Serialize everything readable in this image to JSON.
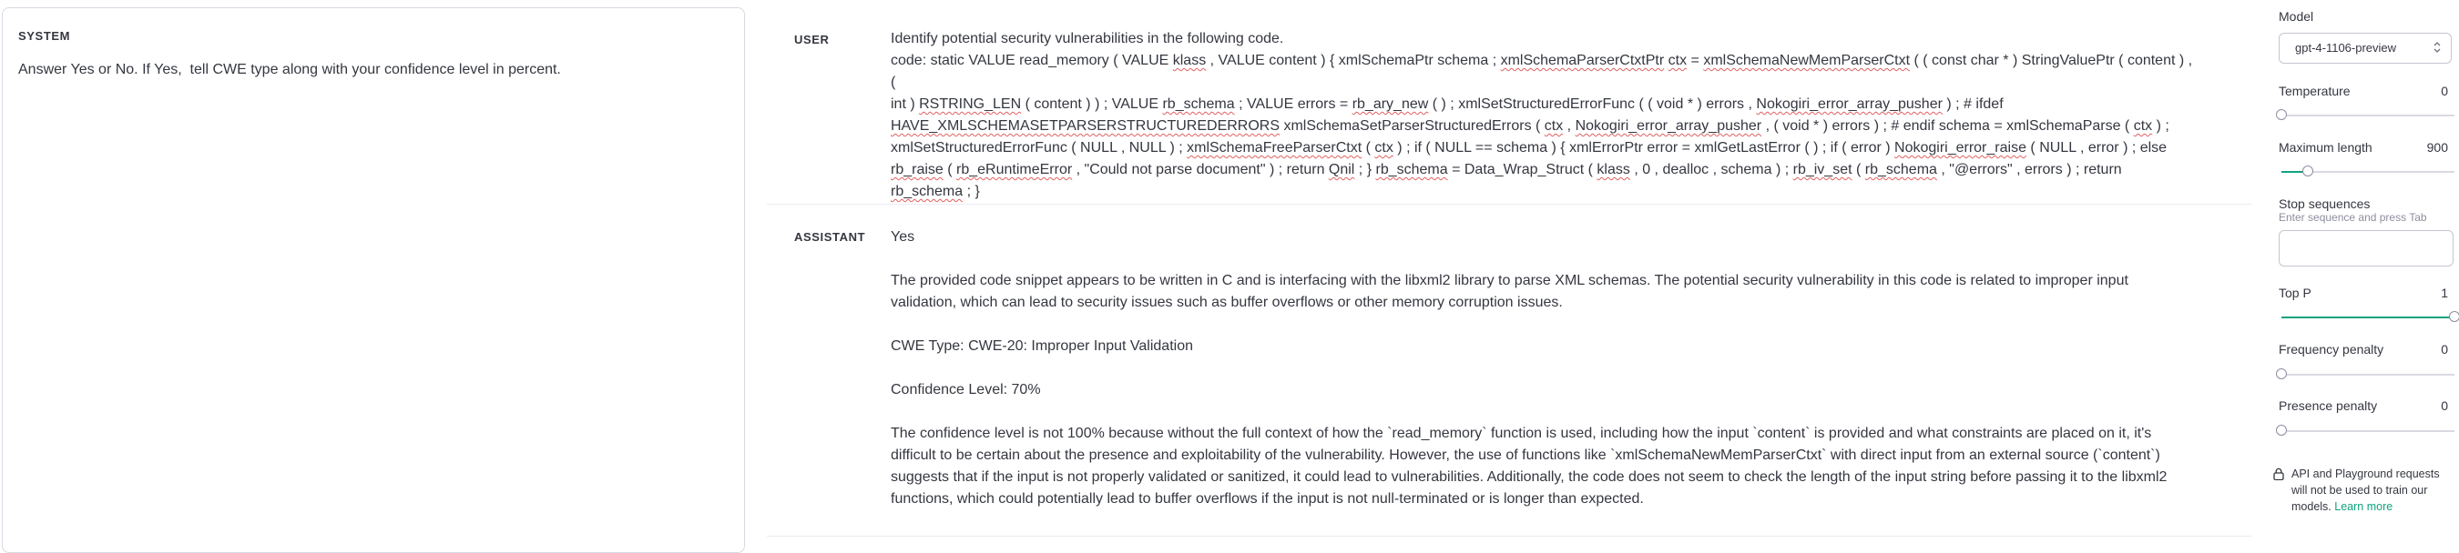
{
  "system": {
    "label": "SYSTEM",
    "text": "Answer Yes or No. If Yes,  tell CWE type along with your confidence level in percent."
  },
  "user": {
    "label": "USER",
    "line1": "Identify potential security vulnerabilities in the following code.",
    "code": [
      [
        {
          "t": "code: static VALUE read_memory ( VALUE "
        },
        {
          "t": "klass",
          "u": 1
        },
        {
          "t": " , VALUE content ) { xmlSchemaPtr schema ; "
        },
        {
          "t": "xmlSchemaParserCtxtPtr",
          "u": 1
        },
        {
          "t": " "
        },
        {
          "t": "ctx",
          "u": 1
        },
        {
          "t": " = "
        },
        {
          "t": "xmlSchemaNewMemParserCtxt",
          "u": 1
        },
        {
          "t": " ( ( const char * ) StringValuePtr ( content ) , ("
        }
      ],
      [
        {
          "t": "int ) "
        },
        {
          "t": "RSTRING_LEN",
          "u": 1
        },
        {
          "t": " ( content ) ) ; VALUE "
        },
        {
          "t": "rb_schema",
          "u": 1
        },
        {
          "t": " ; VALUE errors = "
        },
        {
          "t": "rb_ary_new",
          "u": 1
        },
        {
          "t": " ( ) ; xmlSetStructuredErrorFunc ( ( void * ) errors , "
        },
        {
          "t": "Nokogiri_error_array_pusher",
          "u": 1
        },
        {
          "t": " ) ; # ifdef"
        }
      ],
      [
        {
          "t": "HAVE_XMLSCHEMASETPARSERSTRUCTUREDERRORS",
          "u": 1
        },
        {
          "t": " xmlSchemaSetParserStructuredErrors ( "
        },
        {
          "t": "ctx",
          "u": 1
        },
        {
          "t": " , "
        },
        {
          "t": "Nokogiri_error_array_pusher",
          "u": 1
        },
        {
          "t": " , ( void * ) errors ) ; # endif schema = xmlSchemaParse ( "
        },
        {
          "t": "ctx",
          "u": 1
        },
        {
          "t": " ) ;"
        }
      ],
      [
        {
          "t": "xmlSetStructuredErrorFunc ( NULL , NULL ) ; "
        },
        {
          "t": "xmlSchemaFreeParserCtxt",
          "u": 1
        },
        {
          "t": " ( "
        },
        {
          "t": "ctx",
          "u": 1
        },
        {
          "t": " ) ; if ( NULL == schema ) { xmlErrorPtr error = xmlGetLastError ( ) ; if ( error ) "
        },
        {
          "t": "Nokogiri_error_raise",
          "u": 1
        },
        {
          "t": " ( NULL , error ) ; else"
        }
      ],
      [
        {
          "t": "rb_raise",
          "u": 1
        },
        {
          "t": " ( "
        },
        {
          "t": "rb_eRuntimeError",
          "u": 1
        },
        {
          "t": " , \"Could not parse document\" ) ; return "
        },
        {
          "t": "Qnil",
          "u": 1
        },
        {
          "t": " ; } "
        },
        {
          "t": "rb_schema",
          "u": 1
        },
        {
          "t": " = Data_Wrap_Struct ( "
        },
        {
          "t": "klass",
          "u": 1
        },
        {
          "t": " , 0 , dealloc , schema ) ; "
        },
        {
          "t": "rb_iv_set",
          "u": 1
        },
        {
          "t": " ( "
        },
        {
          "t": "rb_schema",
          "u": 1
        },
        {
          "t": " , \"@errors\" , errors ) ; return "
        },
        {
          "t": "rb_schema",
          "u": 1
        },
        {
          "t": " ; }"
        }
      ]
    ]
  },
  "assistant": {
    "label": "ASSISTANT",
    "answer": "Yes",
    "para1_l1": "The provided code snippet appears to be written in C and is interfacing with the libxml2 library to parse XML schemas. The potential security vulnerability in this code is related to improper input",
    "para1_l2": "validation, which can lead to security issues such as buffer overflows or other memory corruption issues.",
    "cwe": "CWE Type: CWE-20: Improper Input Validation",
    "confidence": "Confidence Level: 70%",
    "para2_l1": "The confidence level is not 100% because without the full context of how the `read_memory` function is used, including how the input `content` is provided and what constraints are placed on it, it's",
    "para2_l2": "difficult to be certain about the presence and exploitability of the vulnerability. However, the use of functions like `xmlSchemaNewMemParserCtxt` with direct input from an external source (`content`)",
    "para2_l3": "suggests that if the input is not properly validated or sanitized, it could lead to vulnerabilities. Additionally, the code does not seem to check the length of the input string before passing it to the libxml2",
    "para2_l4": "functions, which could potentially lead to buffer overflows if the input is not null-terminated or is longer than expected."
  },
  "sidebar": {
    "model_label": "Model",
    "model_value": "gpt-4-1106-preview",
    "temperature_label": "Temperature",
    "temperature_value": "0",
    "temperature_level": 0,
    "max_length_label": "Maximum length",
    "max_length_value": "900",
    "max_length_level": 0.15,
    "stop_label": "Stop sequences",
    "stop_hint": "Enter sequence and press Tab",
    "top_p_label": "Top P",
    "top_p_value": "1",
    "top_p_level": 1,
    "freq_label": "Frequency penalty",
    "freq_value": "0",
    "freq_level": 0,
    "presence_label": "Presence penalty",
    "presence_value": "0",
    "presence_level": 0,
    "notice_text": "API and Playground requests will not be used to train our models.",
    "learn_more": "Learn more",
    "accent_color": "#10a37f"
  }
}
